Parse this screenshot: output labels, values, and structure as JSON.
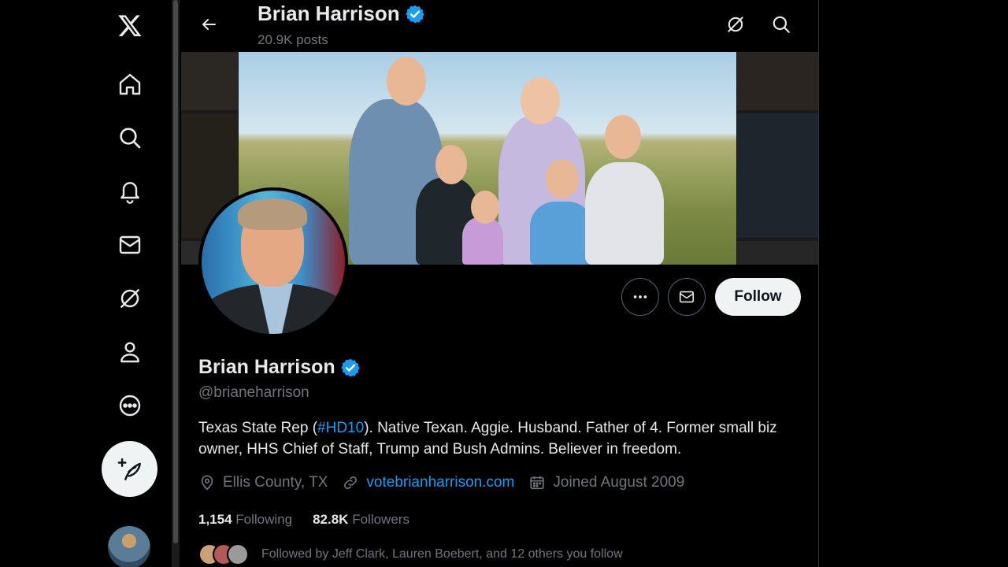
{
  "nav": {
    "items": [
      {
        "name": "x-logo-icon"
      },
      {
        "name": "home-icon"
      },
      {
        "name": "search-icon"
      },
      {
        "name": "notifications-bell-icon"
      },
      {
        "name": "messages-envelope-icon"
      },
      {
        "name": "grok-icon"
      },
      {
        "name": "profile-person-icon"
      },
      {
        "name": "more-circle-icon"
      }
    ],
    "post_icon": "post-feather-icon"
  },
  "header": {
    "name": "Brian Harrison",
    "posts": "20.9K posts"
  },
  "profile": {
    "name": "Brian Harrison",
    "handle": "@brianeharrison",
    "bio_prefix": "Texas State Rep (",
    "bio_hashtag": "#HD10",
    "bio_suffix": "). Native Texan. Aggie. Husband. Father of 4. Former small biz owner, HHS Chief of Staff, Trump and Bush Admins. Believer in freedom.",
    "location": "Ellis County, TX",
    "website": "votebrianharrison.com",
    "joined": "Joined August 2009",
    "following_count": "1,154",
    "following_label": "Following",
    "followers_count": "82.8K",
    "followers_label": "Followers",
    "followed_by": "Followed by Jeff Clark, Lauren Boebert, and 12 others you follow"
  },
  "actions": {
    "follow_label": "Follow"
  },
  "colors": {
    "accent": "#1d9bf0",
    "muted": "#71767b",
    "text": "#e7e9ea",
    "button_light": "#eff3f4"
  }
}
